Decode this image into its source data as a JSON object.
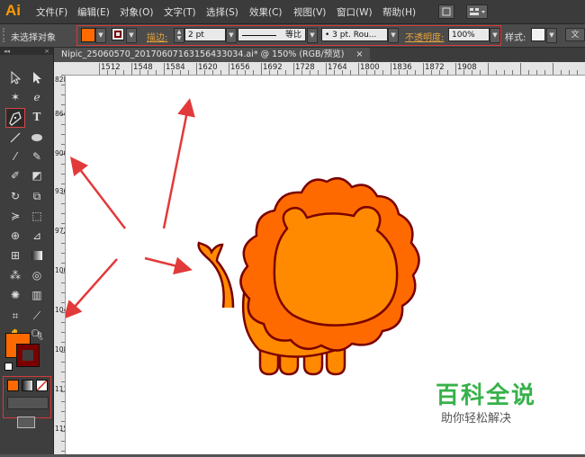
{
  "app": {
    "logo": "Ai"
  },
  "menubar": {
    "items": [
      "文件(F)",
      "编辑(E)",
      "对象(O)",
      "文字(T)",
      "选择(S)",
      "效果(C)",
      "视图(V)",
      "窗口(W)",
      "帮助(H)"
    ]
  },
  "controlbar": {
    "selection_status": "未选择对象",
    "stroke_label": "描边:",
    "stroke_weight": "2 pt",
    "profile_label": "等比",
    "brush": "3 pt. Rou...",
    "opacity_label": "不透明度:",
    "opacity_value": "100%",
    "style_label": "样式:",
    "doc_setup": "文",
    "fill_color": "#ff6a00",
    "stroke_color": "#7a0000"
  },
  "document": {
    "tab_title": "Nipic_25060570_20170607163156433034.ai*  @  150% (RGB/预览)",
    "close_label": "×"
  },
  "ruler": {
    "h_labels": [
      "1512",
      "1548",
      "1584",
      "1620",
      "1656",
      "1692",
      "1728",
      "1764",
      "1800",
      "1836",
      "1872",
      "1908"
    ],
    "v_labels": [
      "828",
      "864",
      "900",
      "936",
      "972",
      "1008",
      "1044",
      "1080",
      "1116",
      "1152"
    ]
  },
  "watermark": {
    "title": "百科全说",
    "subtitle": "助你轻松解决"
  },
  "colors": {
    "lion_mane": "#ff6a00",
    "lion_face": "#ff8a00",
    "lion_outline": "#7a0000",
    "arrow": "#e23a3a",
    "watermark_green": "#37b24a"
  }
}
